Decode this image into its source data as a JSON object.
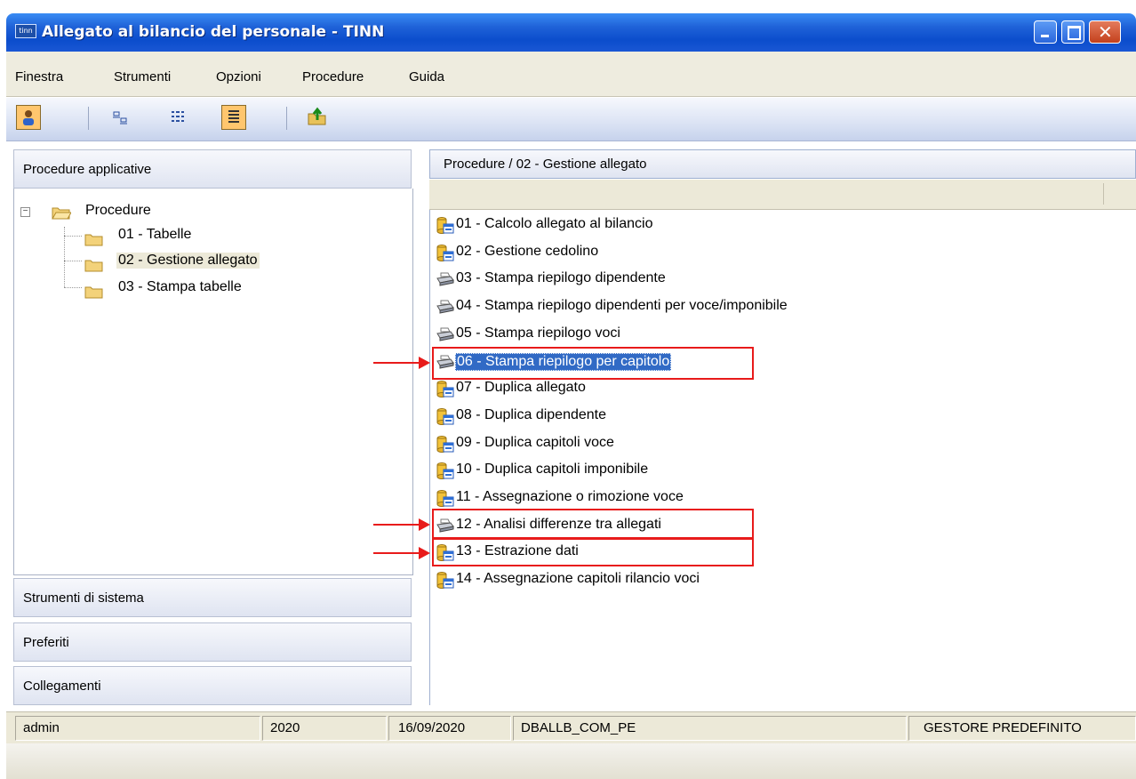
{
  "window": {
    "title": "Allegato al bilancio del personale - TINN",
    "app_icon_text": "tinn"
  },
  "menu": [
    "Finestra",
    "Strumenti",
    "Opzioni",
    "Procedure",
    "Guida"
  ],
  "toolbar": {
    "buttons": [
      "user-icon",
      "small-icons-view-icon",
      "list-view-icon",
      "details-view-icon",
      "up-folder-icon"
    ]
  },
  "left": {
    "panel_title": "Procedure applicative",
    "tree": {
      "root": "Procedure",
      "children": [
        "01 - Tabelle",
        "02 - Gestione allegato",
        "03 - Stampa tabelle"
      ]
    },
    "sections": [
      "Strumenti di sistema",
      "Preferiti",
      "Collegamenti"
    ]
  },
  "right": {
    "path": "Procedure / 02 - Gestione allegato",
    "items": [
      {
        "label": "01 - Calcolo allegato al bilancio",
        "icon": "database-form-icon"
      },
      {
        "label": "02 - Gestione cedolino",
        "icon": "database-form-icon"
      },
      {
        "label": "03 - Stampa riepilogo dipendente",
        "icon": "printer-icon"
      },
      {
        "label": "04 - Stampa riepilogo dipendenti per voce/imponibile",
        "icon": "printer-icon"
      },
      {
        "label": "05 - Stampa riepilogo voci",
        "icon": "printer-icon"
      },
      {
        "label": "06 - Stampa riepilogo per capitolo",
        "icon": "printer-icon"
      },
      {
        "label": "07 - Duplica allegato",
        "icon": "database-form-icon"
      },
      {
        "label": "08 - Duplica dipendente",
        "icon": "database-form-icon"
      },
      {
        "label": "09 - Duplica capitoli voce",
        "icon": "database-form-icon"
      },
      {
        "label": "10 - Duplica capitoli imponibile",
        "icon": "database-form-icon"
      },
      {
        "label": "11 - Assegnazione o rimozione voce",
        "icon": "database-form-icon"
      },
      {
        "label": "12 - Analisi differenze tra allegati",
        "icon": "printer-icon"
      },
      {
        "label": "13 - Estrazione dati",
        "icon": "database-form-icon"
      },
      {
        "label": "14 - Assegnazione capitoli rilancio voci",
        "icon": "database-form-icon"
      }
    ],
    "selected_index": 5
  },
  "status": {
    "user": "admin",
    "year": "2020",
    "date": "16/09/2020",
    "database": "DBALLB_COM_PE",
    "manager": "GESTORE PREDEFINITO"
  },
  "colors": {
    "highlight": "#e81b1b",
    "selection": "#316ac5",
    "titlebar": "#0b4dcc"
  }
}
